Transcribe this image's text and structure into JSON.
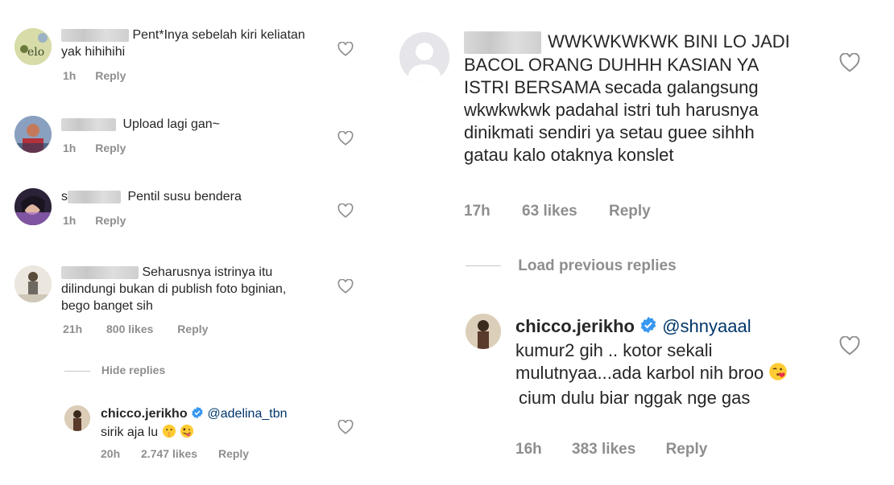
{
  "left": {
    "comments": [
      {
        "text": "Pent*Inya sebelah kiri keliatan yak hihihihi",
        "time": "1h",
        "reply": "Reply"
      },
      {
        "text": "Upload lagi gan~",
        "time": "1h",
        "reply": "Reply"
      },
      {
        "prefix": "s",
        "text": "Pentil susu bendera",
        "time": "1h",
        "reply": "Reply"
      },
      {
        "text": "Seharusnya istrinya itu dilindungi bukan di publish foto bginian, bego banget sih",
        "time": "21h",
        "likes": "800 likes",
        "reply": "Reply"
      }
    ],
    "hide_replies": "Hide replies",
    "reply_comment": {
      "username": "chicco.jerikho",
      "mention": "@adelina_tbn",
      "text": "sirik aja lu",
      "time": "20h",
      "likes": "2.747 likes",
      "reply": "Reply"
    }
  },
  "right": {
    "comment": {
      "text": "WWKWKWKWK BINI LO JADI BACOL ORANG DUHHH KASIAN YA ISTRI BERSAMA  secada galangsung wkwkwkwk padahal istri tuh harusnya dinikmati sendiri ya setau guee sihhh gatau kalo otaknya konslet",
      "time": "17h",
      "likes": "63 likes",
      "reply": "Reply"
    },
    "load_previous": "Load previous replies",
    "reply_comment": {
      "username": "chicco.jerikho",
      "mention": "@shnyaaal",
      "text_before_emoji": "kumur2 gih .. kotor sekali mulutnyaa...ada karbol nih broo",
      "text_after_emoji": "cium dulu biar nggak nge gas",
      "time": "16h",
      "likes": "383 likes",
      "reply": "Reply"
    }
  },
  "colors": {
    "text": "#262626",
    "meta": "#8e8e8e",
    "mention": "#00376b",
    "verified": "#3897f0",
    "blur": "#d3d3d3"
  }
}
